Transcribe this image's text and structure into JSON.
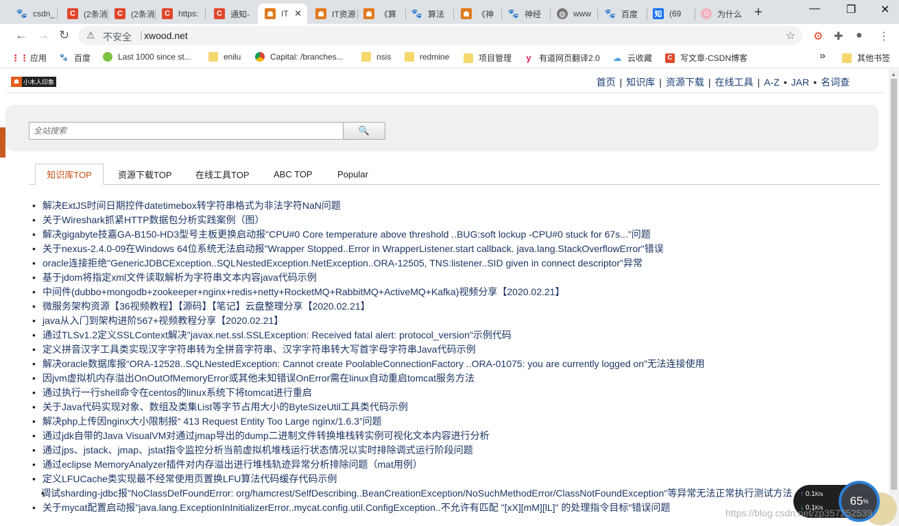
{
  "browser": {
    "tabs": [
      {
        "title": "csdn_",
        "icon": "paw-icon",
        "color": "#2f6fd8"
      },
      {
        "title": "(2条消",
        "icon": "c-icon",
        "color": "#e0462b"
      },
      {
        "title": "(2条消",
        "icon": "c-icon",
        "color": "#e0462b"
      },
      {
        "title": "https:",
        "icon": "c-icon",
        "color": "#e0462b"
      },
      {
        "title": "通知-",
        "icon": "c-icon",
        "color": "#e0462b"
      },
      {
        "title": "IT",
        "icon": "robot-icon",
        "color": "#e07a1d"
      },
      {
        "title": "IT资源",
        "icon": "robot-icon",
        "color": "#e07a1d"
      },
      {
        "title": "《算",
        "icon": "robot-icon",
        "color": "#e07a1d"
      },
      {
        "title": "算法",
        "icon": "paw-icon",
        "color": "#2f6fd8"
      },
      {
        "title": "《神",
        "icon": "robot-icon",
        "color": "#e07a1d"
      },
      {
        "title": "神经",
        "icon": "paw-icon",
        "color": "#2f6fd8"
      },
      {
        "title": "www",
        "icon": "globe-icon",
        "color": "#666666"
      },
      {
        "title": "百度",
        "icon": "paw-icon",
        "color": "#2f6fd8"
      },
      {
        "title": "(69",
        "icon": "zhi-icon",
        "color": "#1772f6"
      },
      {
        "title": "为什么",
        "icon": "person-icon",
        "color": "#f1b3c0"
      }
    ],
    "active_tab_close": "✕",
    "new_tab": "+",
    "window_controls": {
      "minimize": "—",
      "maximize": "❐",
      "close": "✕"
    },
    "address": {
      "warning_icon": "⚠",
      "insecure_label": "不安全",
      "url": "xwood.net",
      "star": "☆"
    },
    "bookmarks": [
      {
        "label": "应用",
        "icon": "apps-icon"
      },
      {
        "label": "百度",
        "icon": "paw-icon"
      },
      {
        "label": "Last 1000 since st...",
        "icon": "leaf-icon"
      },
      {
        "label": "enilu",
        "icon": "folder-icon"
      },
      {
        "label": "Capital: /branches...",
        "icon": "chrome-icon"
      },
      {
        "label": "nsis",
        "icon": "folder-icon"
      },
      {
        "label": "redmine",
        "icon": "folder-icon"
      },
      {
        "label": "项目管理",
        "icon": "folder-icon"
      },
      {
        "label": "有道网页翻译2.0",
        "icon": "youdao-icon"
      },
      {
        "label": "云收藏",
        "icon": "cloud-icon"
      },
      {
        "label": "写文章-CSDN博客",
        "icon": "c-icon"
      }
    ],
    "bookmarks_overflow": "»",
    "other_bookmarks": "其他书签"
  },
  "site": {
    "logo_text": "小木人印象",
    "nav": [
      "首页",
      "知识库",
      "资源下载",
      "在线工具",
      "A-Z",
      "JAR",
      "名词查"
    ],
    "nav_separators": [
      "|",
      "|",
      "|",
      "|",
      "•",
      "•"
    ],
    "search": {
      "placeholder": "全站搜索",
      "button_icon": "🔍"
    },
    "tabs": [
      "知识库TOP",
      "资源下载TOP",
      "在线工具TOP",
      "ABC TOP",
      "Popular"
    ],
    "articles": [
      "解决ExtJS时间日期控件datetimebox转字符串格式为非法字符NaN问题",
      "关于Wireshark抓紧HTTP数据包分析实践案例（图）",
      "解决gigabyte技嘉GA-B150-HD3型号主板更换启动报\"CPU#0 Core temperature above threshold ..BUG:soft lockup -CPU#0 stuck for 67s...\"问题",
      "关于nexus-2.4.0-09在Windows 64位系统无法启动报\"Wrapper Stopped..Error in WrapperListener.start callback. java.lang.StackOverflowError\"错误",
      "oracle连接拒绝\"GenericJDBCException..SQLNestedException.NetException..ORA-12505, TNS:listener..SID given in connect descriptor\"异常",
      "基于jdom将指定xml文件读取解析为字符串文本内容java代码示例",
      "中间件(dubbo+mongodb+zookeeper+nginx+redis+netty+RocketMQ+RabbitMQ+ActiveMQ+Kafka)视频分享【2020.02.21】",
      "微服务架构资源【36视频教程】【源码】【笔记】云盘整理分享【2020.02.21】",
      "java从入门到架构进阶567+视频教程分享【2020.02.21】",
      "通过TLSv1.2定义SSLContext解决\"javax.net.ssl.SSLException: Received fatal alert: protocol_version\"示例代码",
      "定义拼音汉字工具类实现汉字字符串转为全拼音字符串、汉字字符串转大写首字母字符串Java代码示例",
      "解决oracle数据库报“ORA-12528..SQLNestedException: Cannot create PoolableConnectionFactory ..ORA-01075: you are currently logged on”无法连接使用",
      "因jvm虚拟机内存溢出OnOutOfMemoryError或其他未知错误OnError需在linux自动重启tomcat服务方法",
      "通过执行一行shell命令在centos的linux系统下将tomcat进行重启",
      "关于Java代码实现对象、数组及类集List等字节占用大小的ByteSizeUtil工具类代码示例",
      "解决php上传因nginx大小限制报“ 413 Request Entity Too Large nginx/1.6.3”问题",
      "通过jdk自带的Java VisualVM对通过jmap导出的dump二进制文件转换堆栈转实例可视化文本内容进行分析",
      "通过jps、jstack、jmap、jstat指令监控分析当前虚拟机堆栈运行状态情况以实时排除调式运行阶段问题",
      "通过eclipse MemoryAnalyzer插件对内存溢出进行堆栈轨迹异常分析排除问题（mat用例）",
      "定义LFUCache类实现最不经常使用页置换LFU算法代码缓存代码示例",
      "调试sharding-jdbc报\"NoClassDefFoundError: org/hamcrest/SelfDescribing..BeanCreationException/NoSuchMethodError/ClassNotFoundException\"等异常无法正常执行测试方法",
      "关于mycat配置启动报\"java.lang.ExceptionInInitializerError..mycat.config.util.ConfigException..不允许有匹配 \"[xX][mM][lL]\" 的处理指令目标\"错误问题"
    ]
  },
  "overlay": {
    "upload_rate": "0.1",
    "download_rate": "0.1",
    "rate_unit": "K/s",
    "percent": "65",
    "percent_sign": "%",
    "watermark": "https://blog.csdn.net/zp357252539"
  }
}
